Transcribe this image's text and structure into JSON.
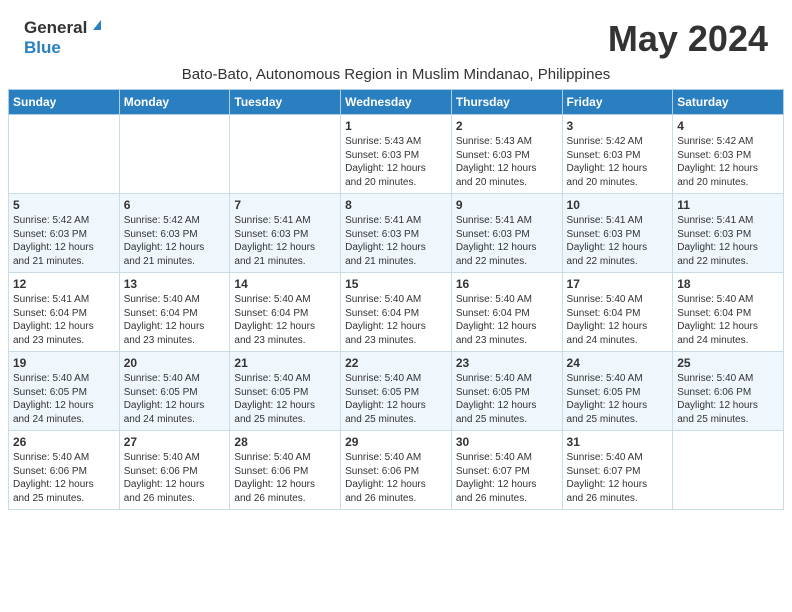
{
  "header": {
    "logo_general": "General",
    "logo_blue": "Blue",
    "month_title": "May 2024",
    "subtitle": "Bato-Bato, Autonomous Region in Muslim Mindanao, Philippines"
  },
  "days_of_week": [
    "Sunday",
    "Monday",
    "Tuesday",
    "Wednesday",
    "Thursday",
    "Friday",
    "Saturday"
  ],
  "weeks": [
    [
      {
        "day": "",
        "content": ""
      },
      {
        "day": "",
        "content": ""
      },
      {
        "day": "",
        "content": ""
      },
      {
        "day": "1",
        "content": "Sunrise: 5:43 AM\nSunset: 6:03 PM\nDaylight: 12 hours\nand 20 minutes."
      },
      {
        "day": "2",
        "content": "Sunrise: 5:43 AM\nSunset: 6:03 PM\nDaylight: 12 hours\nand 20 minutes."
      },
      {
        "day": "3",
        "content": "Sunrise: 5:42 AM\nSunset: 6:03 PM\nDaylight: 12 hours\nand 20 minutes."
      },
      {
        "day": "4",
        "content": "Sunrise: 5:42 AM\nSunset: 6:03 PM\nDaylight: 12 hours\nand 20 minutes."
      }
    ],
    [
      {
        "day": "5",
        "content": "Sunrise: 5:42 AM\nSunset: 6:03 PM\nDaylight: 12 hours\nand 21 minutes."
      },
      {
        "day": "6",
        "content": "Sunrise: 5:42 AM\nSunset: 6:03 PM\nDaylight: 12 hours\nand 21 minutes."
      },
      {
        "day": "7",
        "content": "Sunrise: 5:41 AM\nSunset: 6:03 PM\nDaylight: 12 hours\nand 21 minutes."
      },
      {
        "day": "8",
        "content": "Sunrise: 5:41 AM\nSunset: 6:03 PM\nDaylight: 12 hours\nand 21 minutes."
      },
      {
        "day": "9",
        "content": "Sunrise: 5:41 AM\nSunset: 6:03 PM\nDaylight: 12 hours\nand 22 minutes."
      },
      {
        "day": "10",
        "content": "Sunrise: 5:41 AM\nSunset: 6:03 PM\nDaylight: 12 hours\nand 22 minutes."
      },
      {
        "day": "11",
        "content": "Sunrise: 5:41 AM\nSunset: 6:03 PM\nDaylight: 12 hours\nand 22 minutes."
      }
    ],
    [
      {
        "day": "12",
        "content": "Sunrise: 5:41 AM\nSunset: 6:04 PM\nDaylight: 12 hours\nand 23 minutes."
      },
      {
        "day": "13",
        "content": "Sunrise: 5:40 AM\nSunset: 6:04 PM\nDaylight: 12 hours\nand 23 minutes."
      },
      {
        "day": "14",
        "content": "Sunrise: 5:40 AM\nSunset: 6:04 PM\nDaylight: 12 hours\nand 23 minutes."
      },
      {
        "day": "15",
        "content": "Sunrise: 5:40 AM\nSunset: 6:04 PM\nDaylight: 12 hours\nand 23 minutes."
      },
      {
        "day": "16",
        "content": "Sunrise: 5:40 AM\nSunset: 6:04 PM\nDaylight: 12 hours\nand 23 minutes."
      },
      {
        "day": "17",
        "content": "Sunrise: 5:40 AM\nSunset: 6:04 PM\nDaylight: 12 hours\nand 24 minutes."
      },
      {
        "day": "18",
        "content": "Sunrise: 5:40 AM\nSunset: 6:04 PM\nDaylight: 12 hours\nand 24 minutes."
      }
    ],
    [
      {
        "day": "19",
        "content": "Sunrise: 5:40 AM\nSunset: 6:05 PM\nDaylight: 12 hours\nand 24 minutes."
      },
      {
        "day": "20",
        "content": "Sunrise: 5:40 AM\nSunset: 6:05 PM\nDaylight: 12 hours\nand 24 minutes."
      },
      {
        "day": "21",
        "content": "Sunrise: 5:40 AM\nSunset: 6:05 PM\nDaylight: 12 hours\nand 25 minutes."
      },
      {
        "day": "22",
        "content": "Sunrise: 5:40 AM\nSunset: 6:05 PM\nDaylight: 12 hours\nand 25 minutes."
      },
      {
        "day": "23",
        "content": "Sunrise: 5:40 AM\nSunset: 6:05 PM\nDaylight: 12 hours\nand 25 minutes."
      },
      {
        "day": "24",
        "content": "Sunrise: 5:40 AM\nSunset: 6:05 PM\nDaylight: 12 hours\nand 25 minutes."
      },
      {
        "day": "25",
        "content": "Sunrise: 5:40 AM\nSunset: 6:06 PM\nDaylight: 12 hours\nand 25 minutes."
      }
    ],
    [
      {
        "day": "26",
        "content": "Sunrise: 5:40 AM\nSunset: 6:06 PM\nDaylight: 12 hours\nand 25 minutes."
      },
      {
        "day": "27",
        "content": "Sunrise: 5:40 AM\nSunset: 6:06 PM\nDaylight: 12 hours\nand 26 minutes."
      },
      {
        "day": "28",
        "content": "Sunrise: 5:40 AM\nSunset: 6:06 PM\nDaylight: 12 hours\nand 26 minutes."
      },
      {
        "day": "29",
        "content": "Sunrise: 5:40 AM\nSunset: 6:06 PM\nDaylight: 12 hours\nand 26 minutes."
      },
      {
        "day": "30",
        "content": "Sunrise: 5:40 AM\nSunset: 6:07 PM\nDaylight: 12 hours\nand 26 minutes."
      },
      {
        "day": "31",
        "content": "Sunrise: 5:40 AM\nSunset: 6:07 PM\nDaylight: 12 hours\nand 26 minutes."
      },
      {
        "day": "",
        "content": ""
      }
    ]
  ]
}
